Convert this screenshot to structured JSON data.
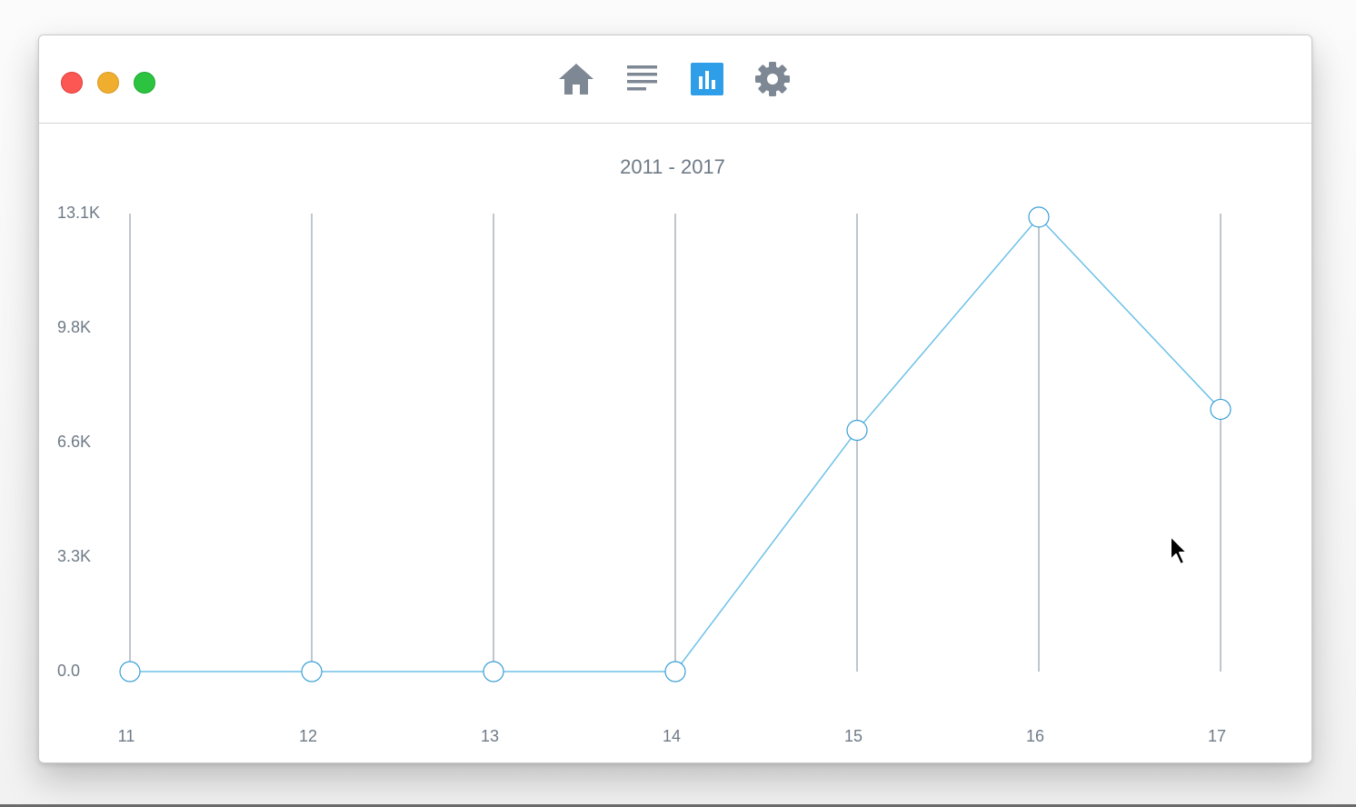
{
  "toolbar": {
    "icons": [
      "home-icon",
      "list-icon",
      "bar-chart-icon",
      "gear-icon"
    ],
    "active_icon": "bar-chart-icon",
    "icon_color": "#7d8894",
    "active_color": "#2f9ee8"
  },
  "chart_data": {
    "type": "line",
    "title": "2011 - 2017",
    "xlabel": "",
    "ylabel": "",
    "categories": [
      "11",
      "12",
      "13",
      "14",
      "15",
      "16",
      "17"
    ],
    "series": [
      {
        "values": [
          0,
          0,
          0,
          0,
          6900,
          13000,
          7500
        ],
        "color": "#6ec1e8"
      }
    ],
    "y_ticks": [
      "0.0",
      "3.3K",
      "6.6K",
      "9.8K",
      "13.1K"
    ],
    "y_tick_values": [
      0,
      3275,
      6550,
      9825,
      13100
    ],
    "ylim": [
      0,
      13100
    ],
    "grid": "vertical",
    "legend": "none"
  }
}
